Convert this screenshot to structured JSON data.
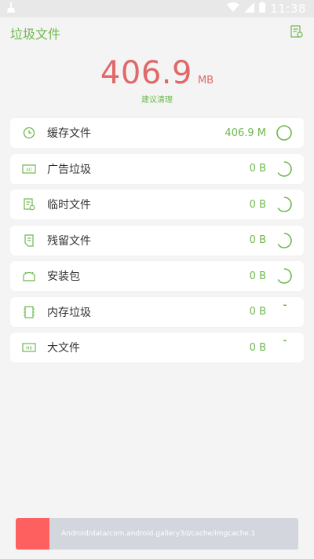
{
  "status_bar": {
    "time": "11:38",
    "icons": [
      "cleaner-broom-icon",
      "wifi-icon",
      "signal-icon",
      "battery-icon"
    ]
  },
  "app_bar": {
    "title": "垃圾文件",
    "action_icon": "report-icon"
  },
  "summary": {
    "size_value": "406.9",
    "size_unit": "MB",
    "advice": "建议清理"
  },
  "categories": [
    {
      "label": "缓存文件",
      "size": "406.9 M",
      "icon": "clock-icon",
      "status": "done"
    },
    {
      "label": "广告垃圾",
      "size": "0 B",
      "icon": "ad-icon",
      "status": "scanning"
    },
    {
      "label": "临时文件",
      "size": "0 B",
      "icon": "temp-file-icon",
      "status": "scanning"
    },
    {
      "label": "残留文件",
      "size": "0 B",
      "icon": "residual-file-icon",
      "status": "scanning"
    },
    {
      "label": "安装包",
      "size": "0 B",
      "icon": "apk-icon",
      "status": "scanning"
    },
    {
      "label": "内存垃圾",
      "size": "0 B",
      "icon": "memory-chip-icon",
      "status": "pending"
    },
    {
      "label": "大文件",
      "size": "0 B",
      "icon": "large-file-icon",
      "status": "pending"
    }
  ],
  "scan_progress": {
    "path": "Android/data/com.android.gallery3d/cache/imgcache.1",
    "fraction": 0.12
  },
  "colors": {
    "accent": "#6fb74f",
    "size_red": "#e06868",
    "progress_fill": "#fe6060",
    "progress_track": "#d3d6dd"
  }
}
